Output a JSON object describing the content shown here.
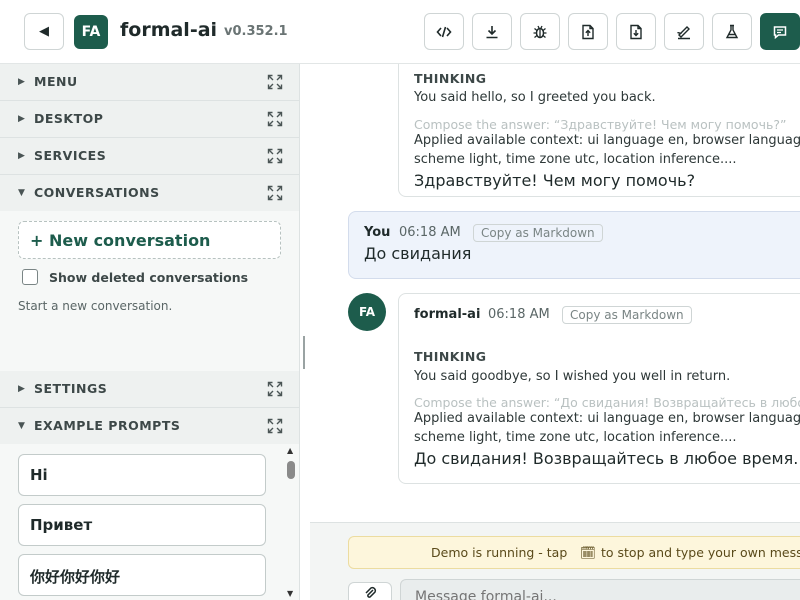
{
  "header": {
    "back_icon": "◀",
    "logo": "FA",
    "title": "formal-ai",
    "version": "v0.352.1",
    "tools": [
      {
        "name": "code-icon"
      },
      {
        "name": "download-icon"
      },
      {
        "name": "bug-icon"
      },
      {
        "name": "upload-file-icon"
      },
      {
        "name": "import-file-icon"
      },
      {
        "name": "sign-icon"
      },
      {
        "name": "flask-icon"
      },
      {
        "name": "chat-icon"
      }
    ]
  },
  "sidebar": {
    "sections": {
      "menu": {
        "label": "MENU",
        "arrow": "▶"
      },
      "desktop": {
        "label": "DESKTOP",
        "arrow": "▶"
      },
      "services": {
        "label": "SERVICES",
        "arrow": "▶"
      },
      "conversations": {
        "label": "CONVERSATIONS",
        "arrow": "▼"
      },
      "settings": {
        "label": "SETTINGS",
        "arrow": "▶"
      },
      "example_prompts": {
        "label": "EXAMPLE PROMPTS",
        "arrow": "▼"
      }
    },
    "conversations": {
      "new_label": "+ New conversation",
      "show_deleted_label": "Show deleted conversations",
      "show_deleted_checked": false,
      "hint": "Start a new conversation."
    },
    "prompts": [
      "Hi",
      "Привет",
      "你好你好你好"
    ]
  },
  "chat": {
    "m1": {
      "thinking_label": "THINKING",
      "thought": "You said hello, so I greeted you back.",
      "compose": "Compose the answer: “Здравствуйте! Чем могу помочь?”",
      "context": "Applied available context: ui language en, browser language en, color scheme light, time zone utc, location inference....",
      "answer": "Здравствуйте! Чем могу помочь?"
    },
    "m2": {
      "author": "You",
      "time": "06:18 AM",
      "copy_label": "Copy as Markdown",
      "text": "До свидания"
    },
    "m3": {
      "avatar": "FA",
      "author": "formal-ai",
      "time": "06:18 AM",
      "copy_label": "Copy as Markdown",
      "thinking_label": "THINKING",
      "thought": "You said goodbye, so I wished you well in return.",
      "compose": "Compose the answer: “До свидания! Возвращайтесь в любое время.”",
      "context": "Applied available context: ui language en, browser language en, color scheme light, time zone utc, location inference....",
      "answer": "До свидания! Возвращайтесь в любое время."
    }
  },
  "composer": {
    "demo_prefix": "Demo is running - tap",
    "demo_icon": "🗓",
    "demo_suffix": "to stop and type your own message",
    "placeholder": "Message formal-ai..."
  }
}
